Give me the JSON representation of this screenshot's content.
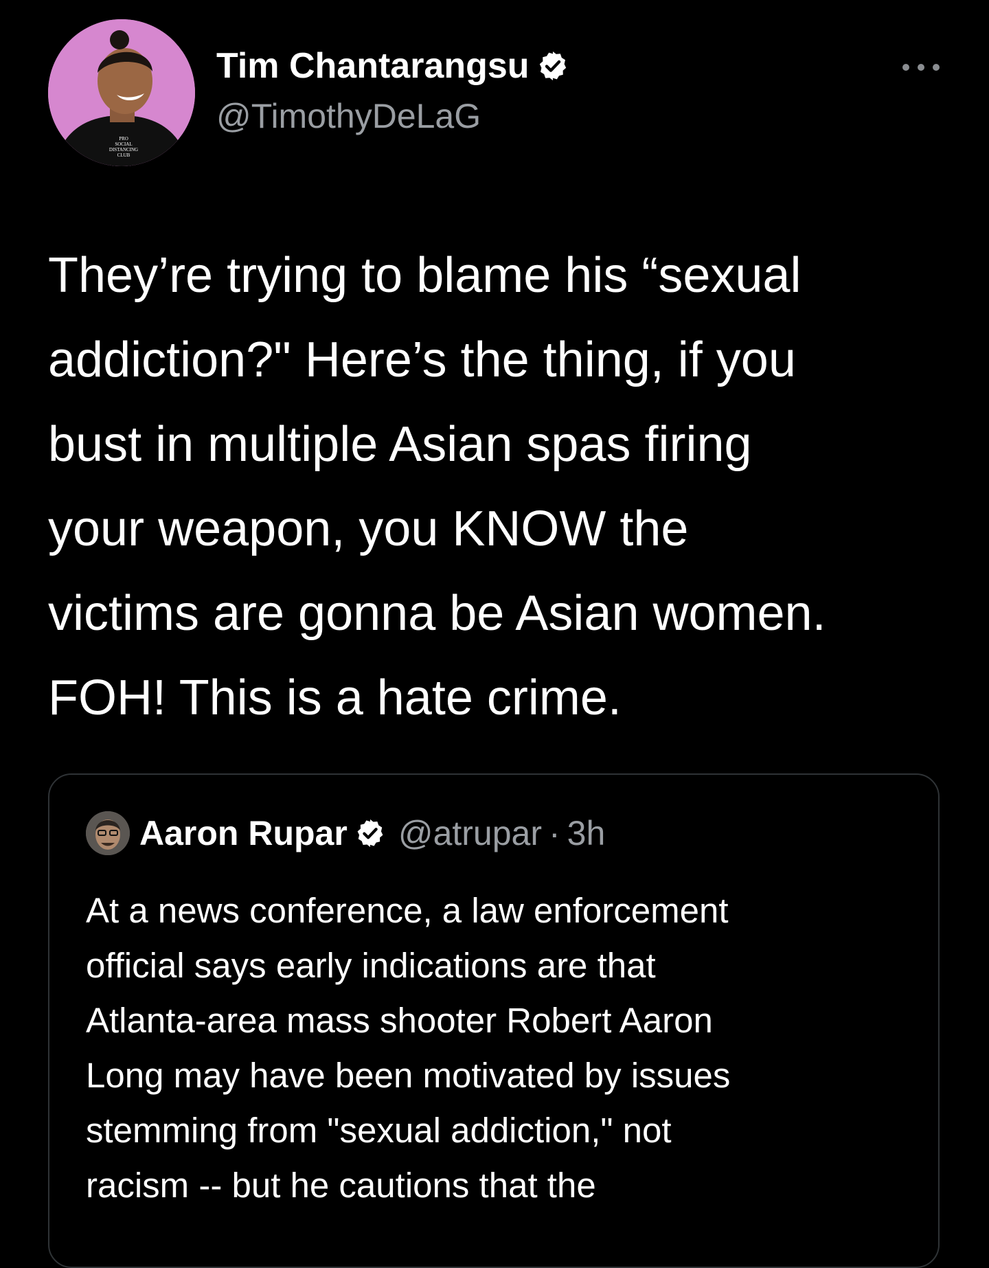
{
  "tweet": {
    "author": {
      "name": "Tim Chantarangsu",
      "handle": "@TimothyDeLaG",
      "verified": true,
      "avatar_shirt_text": [
        "PRO",
        "SOCIAL",
        "DISTANCING",
        "CLUB"
      ]
    },
    "more_icon": "more-horizontal-icon",
    "text_lines": [
      "They’re trying to blame his “sexual",
      "addiction?\" Here’s the thing, if you",
      "bust in multiple Asian spas firing",
      "your weapon, you KNOW the",
      "victims are gonna be Asian women.",
      "FOH! This is a hate crime."
    ]
  },
  "quoted_tweet": {
    "author": {
      "name": "Aaron Rupar",
      "handle": "@atrupar",
      "separator": "·",
      "time": "3h",
      "verified": true
    },
    "text_lines": [
      "At a news conference, a law enforcement",
      "official says early indications are that",
      "Atlanta-area mass shooter Robert Aaron",
      "Long may have been motivated by issues",
      "stemming from \"sexual addiction,\" not",
      "racism -- but he cautions that the"
    ]
  },
  "colors": {
    "background": "#000000",
    "text_primary": "#ffffff",
    "text_secondary": "#9a9ea3",
    "border": "#2f3336",
    "avatar_bg": "#d687cf"
  }
}
